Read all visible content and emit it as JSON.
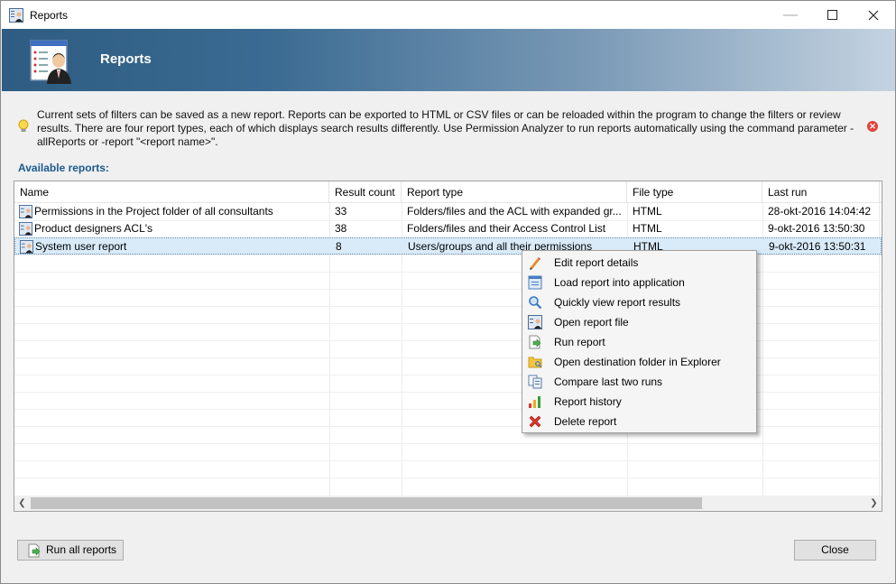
{
  "window": {
    "title": "Reports"
  },
  "banner": {
    "title": "Reports"
  },
  "info": {
    "text": "Current sets of filters can be saved as a new report. Reports can be exported to HTML or CSV files or can be reloaded within the program to change the filters or review results. There are four report types, each of which displays search results differently. Use Permission Analyzer to run reports automatically using the command parameter -allReports or -report \"<report name>\"."
  },
  "section": {
    "label": "Available reports:"
  },
  "grid": {
    "columns": [
      "Name",
      "Result count",
      "Report type",
      "File type",
      "Last run"
    ],
    "rows": [
      {
        "name": "Permissions in the Project folder of all consultants",
        "count": "33",
        "type": "Folders/files and the ACL with expanded gr...",
        "file": "HTML",
        "last": "28-okt-2016 14:04:42"
      },
      {
        "name": "Product designers ACL's",
        "count": "38",
        "type": "Folders/files and their Access Control List",
        "file": "HTML",
        "last": "9-okt-2016 13:50:30"
      },
      {
        "name": "System user report",
        "count": "8",
        "type": "Users/groups and all their permissions",
        "file": "HTML",
        "last": "9-okt-2016 13:50:31"
      }
    ]
  },
  "context_menu": {
    "items": [
      {
        "label": "Edit report details",
        "icon": "pencil-icon"
      },
      {
        "label": "Load report into application",
        "icon": "load-report-icon"
      },
      {
        "label": "Quickly view report results",
        "icon": "magnifier-icon"
      },
      {
        "label": "Open report file",
        "icon": "report-file-icon"
      },
      {
        "label": "Run report",
        "icon": "run-icon"
      },
      {
        "label": "Open destination folder in Explorer",
        "icon": "folder-icon"
      },
      {
        "label": "Compare last two runs",
        "icon": "compare-icon"
      },
      {
        "label": "Report history",
        "icon": "bar-chart-icon"
      },
      {
        "label": "Delete report",
        "icon": "delete-icon"
      }
    ]
  },
  "buttons": {
    "run_all": "Run all reports",
    "close": "Close"
  }
}
